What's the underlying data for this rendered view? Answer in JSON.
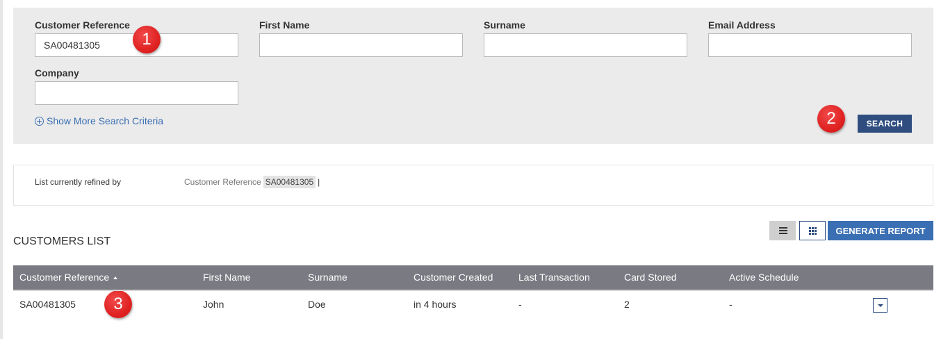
{
  "search": {
    "fields": {
      "customer_reference": {
        "label": "Customer Reference",
        "value": "SA00481305"
      },
      "first_name": {
        "label": "First Name",
        "value": ""
      },
      "surname": {
        "label": "Surname",
        "value": ""
      },
      "email": {
        "label": "Email Address",
        "value": ""
      },
      "company": {
        "label": "Company",
        "value": ""
      }
    },
    "show_more": "Show More Search Criteria",
    "button": "SEARCH"
  },
  "markers": [
    "1",
    "2",
    "3"
  ],
  "refined": {
    "label": "List currently refined by",
    "filter_name": "Customer Reference",
    "filter_value": "SA00481305",
    "separator": "|"
  },
  "list": {
    "title": "CUSTOMERS LIST",
    "generate_report": "GENERATE REPORT",
    "view_icons": [
      "list-view-icon",
      "grid-view-icon"
    ]
  },
  "table": {
    "columns": [
      "Customer Reference",
      "First Name",
      "Surname",
      "Customer Created",
      "Last Transaction",
      "Card Stored",
      "Active Schedule"
    ],
    "sorted_column": "Customer Reference",
    "sort_direction": "ascending",
    "rows": [
      [
        "SA00481305",
        "John",
        "Doe",
        "in 4 hours",
        "-",
        "2",
        "-"
      ]
    ]
  },
  "colors": {
    "panel_bg": "#ebebeb",
    "search_button": "#2f4e7f",
    "generate_button": "#3b6fb3",
    "table_header": "#7a7a82",
    "marker": "#e02222",
    "link": "#3b6fb3"
  }
}
